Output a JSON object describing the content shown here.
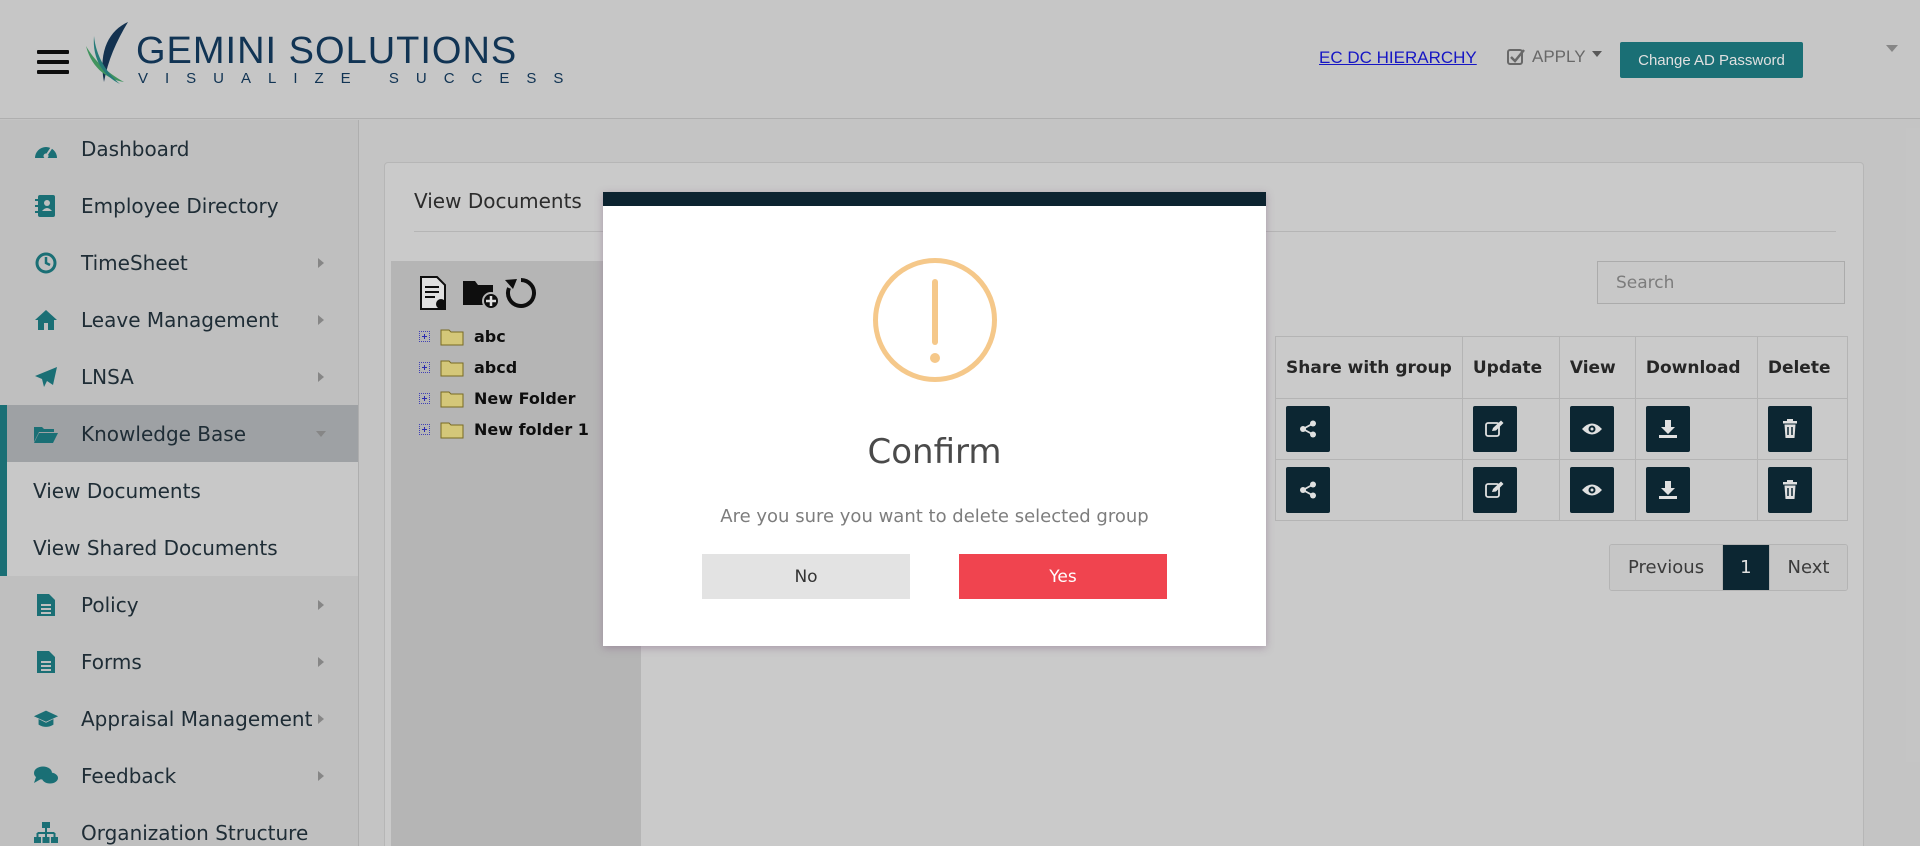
{
  "header": {
    "logo_main": "GEMINI SOLUTIONS",
    "logo_tagline": "VISUALIZE SUCCESS",
    "hierarchy_link": "EC DC HIERARCHY",
    "apply_label": "APPLY",
    "change_password_label": "Change AD Password"
  },
  "sidebar": {
    "items": [
      {
        "label": "Dashboard",
        "icon": "dashboard-icon"
      },
      {
        "label": "Employee Directory",
        "icon": "contact-book-icon"
      },
      {
        "label": "TimeSheet",
        "icon": "clock-icon"
      },
      {
        "label": "Leave Management",
        "icon": "home-icon"
      },
      {
        "label": "LNSA",
        "icon": "paper-plane-icon"
      },
      {
        "label": "Knowledge Base",
        "icon": "folder-open-icon"
      },
      {
        "label": "Policy",
        "icon": "document-icon"
      },
      {
        "label": "Forms",
        "icon": "document-icon"
      },
      {
        "label": "Appraisal Management",
        "icon": "graduation-cap-icon"
      },
      {
        "label": "Feedback",
        "icon": "chat-icon"
      },
      {
        "label": "Organization Structure",
        "icon": "sitemap-icon"
      }
    ],
    "sub_items": [
      "View Documents",
      "View Shared Documents"
    ]
  },
  "main": {
    "title": "View Documents",
    "search_placeholder": "Search",
    "tree": [
      "abc",
      "abcd",
      "New Folder",
      "New folder 1"
    ],
    "table_headers": [
      "Share with group",
      "Update",
      "View",
      "Download",
      "Delete"
    ],
    "pagination": {
      "previous": "Previous",
      "current": "1",
      "next": "Next"
    }
  },
  "modal": {
    "title": "Confirm",
    "message": "Are you sure you want to delete selected group",
    "no_label": "No",
    "yes_label": "Yes"
  },
  "colors": {
    "accent": "#1e7f86",
    "dark": "#0e2c39",
    "danger": "#f0444f",
    "warning": "#f5c88a"
  }
}
